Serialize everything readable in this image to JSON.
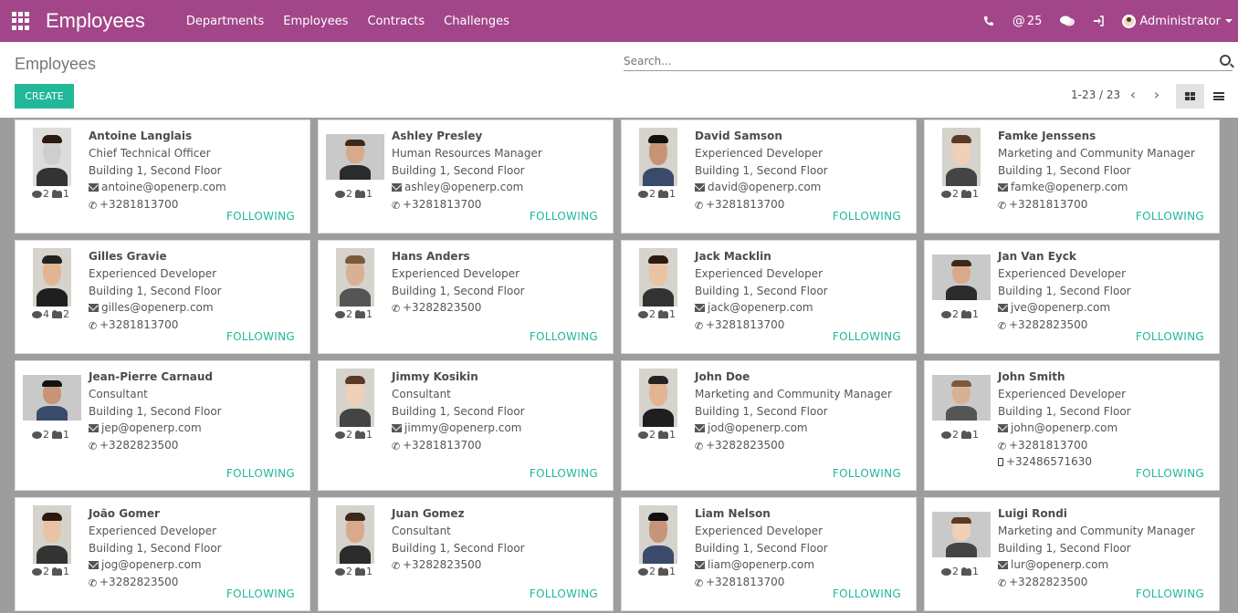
{
  "app": {
    "title": "Employees",
    "menu": [
      "Departments",
      "Employees",
      "Contracts",
      "Challenges"
    ],
    "systray": {
      "mentions": "25",
      "user": "Administrator"
    }
  },
  "control": {
    "breadcrumb": "Employees",
    "search_placeholder": "Search...",
    "create_label": "CREATE",
    "pager": "1-23 / 23"
  },
  "colors": {
    "topbar": "#a24689",
    "accent": "#21b799"
  },
  "employees": [
    {
      "name": "Antoine Langlais",
      "job": "Chief Technical Officer",
      "location": "Building 1, Second Floor",
      "email": "antoine@openerp.com",
      "phone": "+3281813700",
      "mobile": "",
      "messages": "2",
      "followers": "1",
      "follow": "FOLLOWING",
      "photo": "portrait-bw"
    },
    {
      "name": "Ashley Presley",
      "job": "Human Resources Manager",
      "location": "Building 1, Second Floor",
      "email": "ashley@openerp.com",
      "phone": "+3281813700",
      "mobile": "",
      "messages": "2",
      "followers": "1",
      "follow": "FOLLOWING",
      "photo": "portrait-wide"
    },
    {
      "name": "David Samson",
      "job": "Experienced Developer",
      "location": "Building 1, Second Floor",
      "email": "david@openerp.com",
      "phone": "+3281813700",
      "mobile": "",
      "messages": "2",
      "followers": "1",
      "follow": "FOLLOWING",
      "photo": "portrait-tall"
    },
    {
      "name": "Famke Jenssens",
      "job": "Marketing and Community Manager",
      "location": "Building 1, Second Floor",
      "email": "famke@openerp.com",
      "phone": "+3281813700",
      "mobile": "",
      "messages": "2",
      "followers": "1",
      "follow": "FOLLOWING",
      "photo": "portrait-tall"
    },
    {
      "name": "Gilles Gravie",
      "job": "Experienced Developer",
      "location": "Building 1, Second Floor",
      "email": "gilles@openerp.com",
      "phone": "+3281813700",
      "mobile": "",
      "messages": "4",
      "followers": "2",
      "follow": "FOLLOWING",
      "photo": "portrait-tall"
    },
    {
      "name": "Hans Anders",
      "job": "Experienced Developer",
      "location": "Building 1, Second Floor",
      "email": "",
      "phone": "+3282823500",
      "mobile": "",
      "messages": "2",
      "followers": "1",
      "follow": "FOLLOWING",
      "photo": "portrait-tall"
    },
    {
      "name": "Jack Macklin",
      "job": "Experienced Developer",
      "location": "Building 1, Second Floor",
      "email": "jack@openerp.com",
      "phone": "+3281813700",
      "mobile": "",
      "messages": "2",
      "followers": "1",
      "follow": "FOLLOWING",
      "photo": "portrait-tall"
    },
    {
      "name": "Jan Van Eyck",
      "job": "Experienced Developer",
      "location": "Building 1, Second Floor",
      "email": "jve@openerp.com",
      "phone": "+3282823500",
      "mobile": "",
      "messages": "2",
      "followers": "1",
      "follow": "FOLLOWING",
      "photo": "portrait-wide"
    },
    {
      "name": "Jean-Pierre Carnaud",
      "job": "Consultant",
      "location": "Building 1, Second Floor",
      "email": "jep@openerp.com",
      "phone": "+3282823500",
      "mobile": "",
      "messages": "2",
      "followers": "1",
      "follow": "FOLLOWING",
      "photo": "portrait-wide"
    },
    {
      "name": "Jimmy Kosikin",
      "job": "Consultant",
      "location": "Building 1, Second Floor",
      "email": "jimmy@openerp.com",
      "phone": "+3281813700",
      "mobile": "",
      "messages": "2",
      "followers": "1",
      "follow": "FOLLOWING",
      "photo": "portrait-tall"
    },
    {
      "name": "John Doe",
      "job": "Marketing and Community Manager",
      "location": "Building 1, Second Floor",
      "email": "jod@openerp.com",
      "phone": "+3282823500",
      "mobile": "",
      "messages": "2",
      "followers": "1",
      "follow": "FOLLOWING",
      "photo": "portrait-tall"
    },
    {
      "name": "John Smith",
      "job": "Experienced Developer",
      "location": "Building 1, Second Floor",
      "email": "john@openerp.com",
      "phone": "+3281813700",
      "mobile": "+32486571630",
      "messages": "2",
      "followers": "1",
      "follow": "FOLLOWING",
      "photo": "portrait-wide"
    },
    {
      "name": "João Gomer",
      "job": "Experienced Developer",
      "location": "Building 1, Second Floor",
      "email": "jog@openerp.com",
      "phone": "+3282823500",
      "mobile": "",
      "messages": "2",
      "followers": "1",
      "follow": "FOLLOWING",
      "photo": "portrait-tall"
    },
    {
      "name": "Juan Gomez",
      "job": "Consultant",
      "location": "Building 1, Second Floor",
      "email": "",
      "phone": "+3282823500",
      "mobile": "",
      "messages": "2",
      "followers": "1",
      "follow": "FOLLOWING",
      "photo": "portrait-tall"
    },
    {
      "name": "Liam Nelson",
      "job": "Experienced Developer",
      "location": "Building 1, Second Floor",
      "email": "liam@openerp.com",
      "phone": "+3281813700",
      "mobile": "",
      "messages": "2",
      "followers": "1",
      "follow": "FOLLOWING",
      "photo": "portrait-tall"
    },
    {
      "name": "Luigi Rondi",
      "job": "Marketing and Community Manager",
      "location": "Building 1, Second Floor",
      "email": "lur@openerp.com",
      "phone": "+3282823500",
      "mobile": "",
      "messages": "2",
      "followers": "1",
      "follow": "FOLLOWING",
      "photo": "portrait-wide"
    }
  ]
}
